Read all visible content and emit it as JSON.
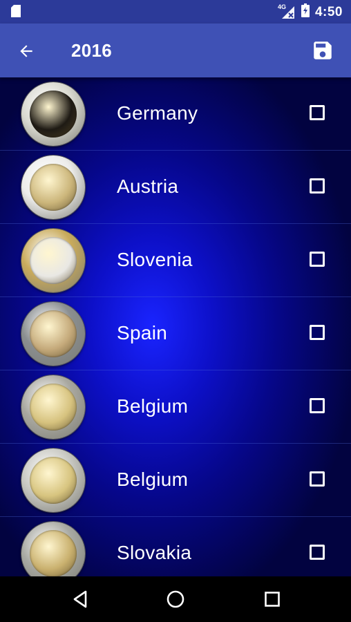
{
  "status_bar": {
    "time": "4:50",
    "network": "4G",
    "icons": [
      "sd-card-icon",
      "signal-icon",
      "battery-icon"
    ]
  },
  "app_bar": {
    "title": "2016",
    "back_icon": "arrow-left-icon",
    "save_icon": "floppy-disk-icon"
  },
  "coins": [
    {
      "country": "Germany",
      "checked": false,
      "rim": "#d9d9d0",
      "center": "#1e1a14"
    },
    {
      "country": "Austria",
      "checked": false,
      "rim": "#ececea",
      "center": "#cbb57a"
    },
    {
      "country": "Slovenia",
      "checked": false,
      "rim": "#c9ab5c",
      "center": "#e9e8e4"
    },
    {
      "country": "Spain",
      "checked": false,
      "rim": "#8a8e90",
      "center": "#c4a97a"
    },
    {
      "country": "Belgium",
      "checked": false,
      "rim": "#a9a8a0",
      "center": "#d6c27e"
    },
    {
      "country": "Belgium",
      "checked": false,
      "rim": "#c8c8c2",
      "center": "#d7c47f"
    },
    {
      "country": "Slovakia",
      "checked": false,
      "rim": "#a9aaa3",
      "center": "#c9b06e"
    }
  ],
  "nav_bar": {
    "back": "triangle-back-icon",
    "home": "circle-home-icon",
    "recents": "square-recents-icon"
  },
  "colors": {
    "status_bar": "#2c3a99",
    "app_bar": "#3f51b5",
    "list_bg_center": "#1a24ff",
    "list_bg_edge": "#020340"
  }
}
